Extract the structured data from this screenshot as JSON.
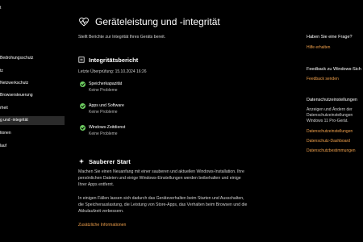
{
  "sidebar": {
    "title": "t",
    "items": [
      {
        "label": "Bedrohungsschutz"
      },
      {
        "label": "tz"
      },
      {
        "label": "Netzwerkschutz"
      },
      {
        "label": "Browsersteuerung"
      },
      {
        "label": "rheit"
      },
      {
        "label": "g und -integrität"
      },
      {
        "label": "tionen"
      },
      {
        "label": "lauf"
      }
    ]
  },
  "main": {
    "title": "Geräteleistung und -integrität",
    "subtitle": "Stellt Berichte zur Integrität Ihres Geräts bereit.",
    "report": {
      "title": "Integritätsbericht",
      "last_check": "Letzte Überprüfung: 15.10.2024 16:26",
      "items": [
        {
          "name": "Speicherkapazität",
          "status": "Keine Probleme"
        },
        {
          "name": "Apps und Software",
          "status": "Keine Probleme"
        },
        {
          "name": "Windows-Zeitdienst",
          "status": "Keine Probleme"
        }
      ]
    },
    "fresh_start": {
      "title": "Sauberer Start",
      "para1": "Machen Sie einen Neuanfang mit einer sauberen und aktuellen Windows-Installation. Ihre persönlichen Dateien und einige Windows-Einstellungen werden beibehalten und einige Ihrer Apps entfernt.",
      "para2": "In einigen Fällen lassen sich dadurch das Geräteverhalten beim Starten und Ausschalten, die Speicherauslastung, die Leistung von Store-Apps, das Verhalten beim Browsen und die Akkulaufzeit verbessern.",
      "link": "Zusätzliche Informationen"
    }
  },
  "right": {
    "question_head": "Haben Sie eine Frage?",
    "help_link": "Hilfe erhalten",
    "feedback_head": "Feedback zu Windows-Sich",
    "feedback_link": "Feedback senden",
    "privacy_head": "Datenschutzeinstellungen",
    "privacy_text": "Anzeigen und Ändern der Datenschutzeinstellungen Windows 11 Pro-Gerät.",
    "privacy_links": [
      "Datenschutzeinstellungen",
      "Datenschutz-Dashboard",
      "Datenschutzbestimmungen"
    ]
  },
  "colors": {
    "accent": "#f0a04b",
    "ok": "#6ccb5f",
    "selected_bg": "#2b2b2b"
  }
}
